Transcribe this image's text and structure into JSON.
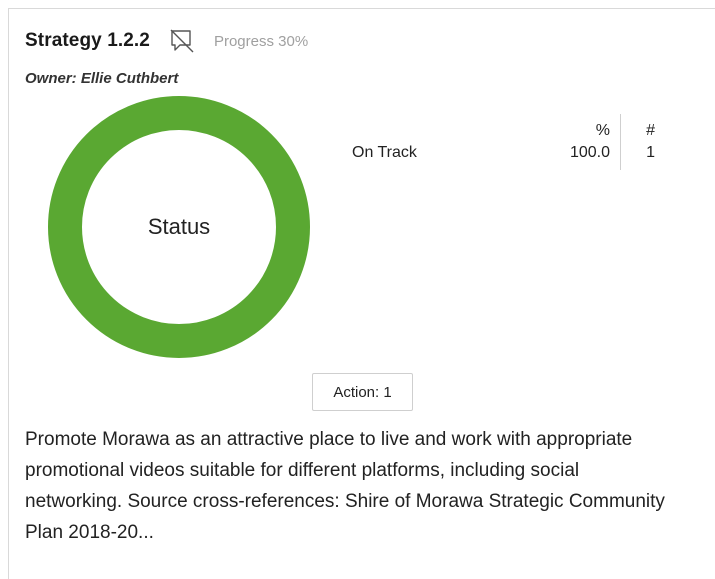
{
  "card": {
    "title": "Strategy 1.2.2",
    "progress": "Progress 30%",
    "progress_value": 30,
    "owner": "Owner: Ellie Cuthbert",
    "comment_icon": "comment-off-icon"
  },
  "status_chart": {
    "center_label": "Status",
    "legend_header_pct": "%",
    "legend_header_count": "#",
    "rows": [
      {
        "label": "On Track",
        "pct": "100.0",
        "count": "1",
        "color": "#5aa832"
      }
    ]
  },
  "chart_data": {
    "type": "pie",
    "categories": [
      "On Track"
    ],
    "values": [
      100.0
    ],
    "title": "Status",
    "colors": [
      "#5aa832"
    ]
  },
  "action_button": {
    "label": "Action: 1"
  },
  "description": "Promote Morawa as an attractive place to live and work with appropriate promotional videos suitable for different platforms, including social networking. Source cross-references: Shire of Morawa Strategic Community Plan 2018-20..."
}
